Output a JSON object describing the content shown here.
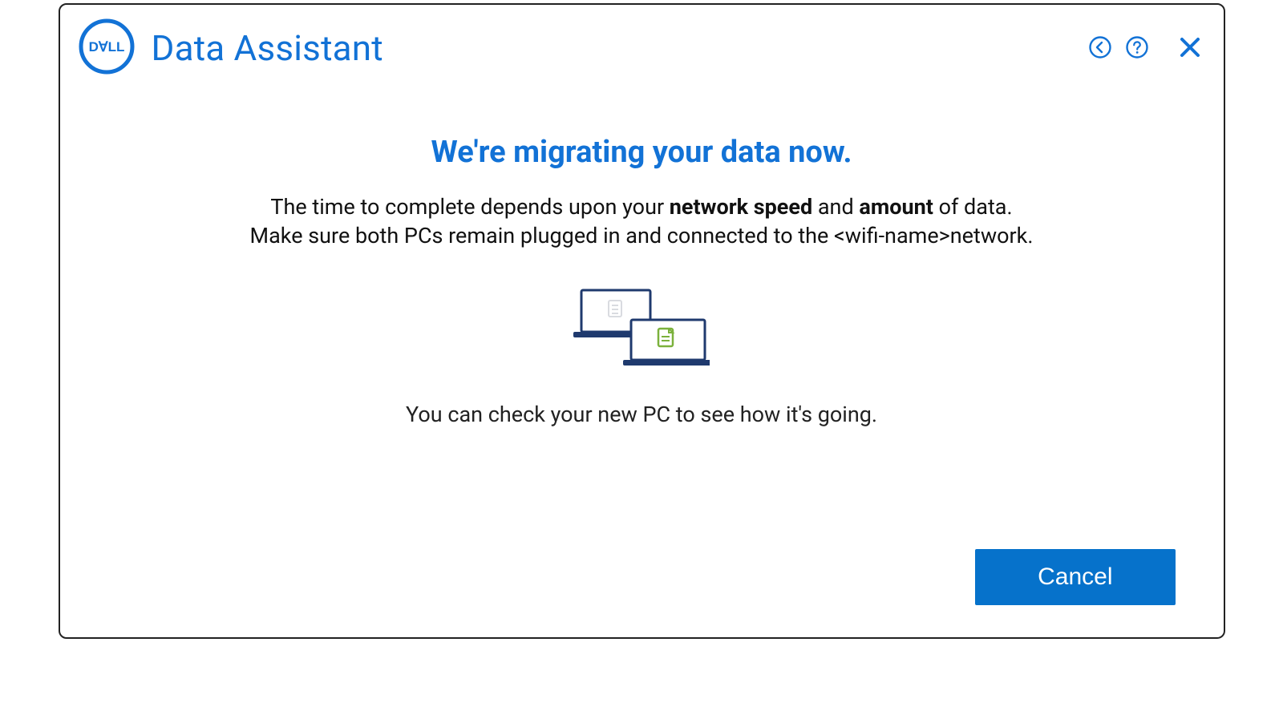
{
  "header": {
    "app_title": "Data Assistant"
  },
  "main": {
    "headline": "We're migrating your data now.",
    "sub_line1_a": "The time to complete depends upon your ",
    "sub_line1_strong1": "network speed",
    "sub_line1_b": " and ",
    "sub_line1_strong2": "amount",
    "sub_line1_c": " of data.",
    "sub_line2_a": "Make sure both PCs remain plugged in and connected to the ",
    "sub_line2_wifi": "<wifi-name>",
    "sub_line2_b": "network.",
    "check_text": "You can check your new PC to see how it's going."
  },
  "footer": {
    "cancel_label": "Cancel"
  },
  "colors": {
    "brand_blue": "#1272d6",
    "button_blue": "#0672cb"
  }
}
